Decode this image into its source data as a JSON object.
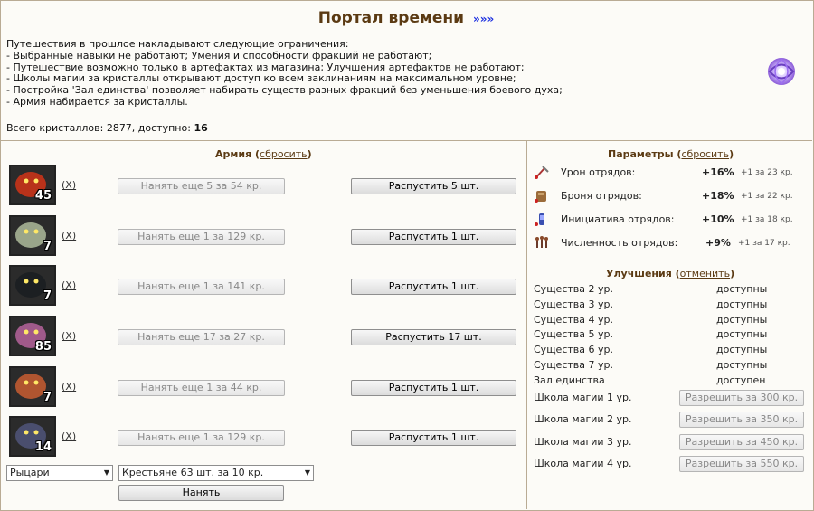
{
  "header": {
    "title": "Портал времени",
    "more_link": "»»»"
  },
  "intro": {
    "lines": [
      "Путешествия в прошлое накладывают следующие ограничения:",
      "- Выбранные навыки не работают; Умения и способности фракций не работают;",
      "- Путешествие возможно только в артефактах из магазина; Улучшения артефактов не работают;",
      "- Школы магии за кристаллы открывают доступ ко всем заклинаниям на максимальном уровне;",
      "- Постройка 'Зал единства' позволяет набирать существ разных фракций без уменьшения боевого духа;",
      "- Армия набирается за кристаллы."
    ],
    "crystals_label": "Всего кристаллов: 2877, доступно:",
    "crystals_available": "16"
  },
  "army": {
    "title": "Армия",
    "reset_link": "сбросить",
    "remove_label": "(X)",
    "rows": [
      {
        "qty": "45",
        "hire": "Нанять еще 5 за 54 кр.",
        "dismiss": "Распустить 5 шт.",
        "color": "#b8321a"
      },
      {
        "qty": "7",
        "hire": "Нанять еще 1 за 129 кр.",
        "dismiss": "Распустить 1 шт.",
        "color": "#9aa58a"
      },
      {
        "qty": "7",
        "hire": "Нанять еще 1 за 141 кр.",
        "dismiss": "Распустить 1 шт.",
        "color": "#1c1f22"
      },
      {
        "qty": "85",
        "hire": "Нанять еще 17 за 27 кр.",
        "dismiss": "Распустить 17 шт.",
        "color": "#a05a8a"
      },
      {
        "qty": "7",
        "hire": "Нанять еще 1 за 44 кр.",
        "dismiss": "Распустить 1 шт.",
        "color": "#b05530"
      },
      {
        "qty": "14",
        "hire": "Нанять еще 1 за 129 кр.",
        "dismiss": "Распустить 1 шт.",
        "color": "#4a4e6e"
      }
    ],
    "faction_select": "Рыцари",
    "unit_select": "Крестьяне 63 шт. за 10 кр.",
    "hire_button": "Нанять"
  },
  "params": {
    "title": "Параметры",
    "reset_link": "сбросить",
    "rows": [
      {
        "icon": "sword-icon",
        "label": "Урон отрядов:",
        "value": "+16%",
        "cost": "+1 за 23 кр."
      },
      {
        "icon": "armor-icon",
        "label": "Броня отрядов:",
        "value": "+18%",
        "cost": "+1 за 22 кр."
      },
      {
        "icon": "potion-icon",
        "label": "Инициатива отрядов:",
        "value": "+10%",
        "cost": "+1 за 18 кр."
      },
      {
        "icon": "soldiers-icon",
        "label": "Численность отрядов:",
        "value": "+9%",
        "cost": "+1 за 17 кр."
      }
    ]
  },
  "upgrades": {
    "title": "Улучшения",
    "cancel_link": "отменить",
    "rows": [
      {
        "label": "Существа 2 ур.",
        "status": "доступны"
      },
      {
        "label": "Существа 3 ур.",
        "status": "доступны"
      },
      {
        "label": "Существа 4 ур.",
        "status": "доступны"
      },
      {
        "label": "Существа 5 ур.",
        "status": "доступны"
      },
      {
        "label": "Существа 6 ур.",
        "status": "доступны"
      },
      {
        "label": "Существа 7 ур.",
        "status": "доступны"
      },
      {
        "label": "Зал единства",
        "status": "доступен"
      }
    ],
    "schools": [
      {
        "label": "Школа магии 1 ур.",
        "button": "Разрешить за 300 кр."
      },
      {
        "label": "Школа магии 2 ур.",
        "button": "Разрешить за 350 кр."
      },
      {
        "label": "Школа магии 3 ур.",
        "button": "Разрешить за 450 кр."
      },
      {
        "label": "Школа магии 4 ур.",
        "button": "Разрешить за 550 кр."
      }
    ]
  },
  "colors": {
    "border": "#b9ab94",
    "title": "#5b3a13",
    "link": "#1b2ee0"
  }
}
